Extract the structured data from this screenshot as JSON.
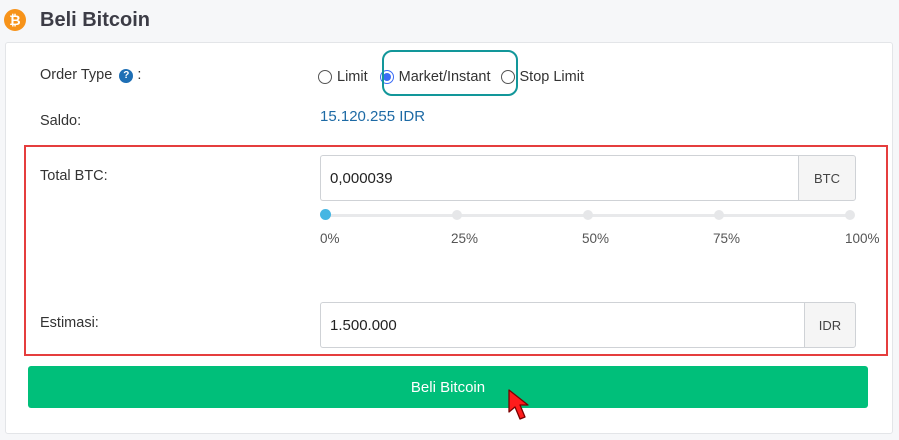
{
  "header": {
    "title": "Beli Bitcoin",
    "logo_glyph": "₿"
  },
  "order_type": {
    "label": "Order Type",
    "suffix": ":",
    "help_glyph": "?",
    "options": [
      {
        "label": "Limit",
        "checked": false
      },
      {
        "label": "Market/Instant",
        "checked": true
      },
      {
        "label": "Stop Limit",
        "checked": false
      }
    ]
  },
  "saldo": {
    "label": "Saldo:",
    "value": "15.120.255 IDR"
  },
  "total_btc": {
    "label": "Total BTC:",
    "value": "0,000039",
    "unit": "BTC"
  },
  "slider": {
    "value_percent": 0,
    "ticks": [
      "0%",
      "25%",
      "50%",
      "75%",
      "100%"
    ]
  },
  "estimasi": {
    "label": "Estimasi:",
    "value": "1.500.000",
    "unit": "IDR"
  },
  "buy_button": {
    "label": "Beli Bitcoin"
  },
  "colors": {
    "accent_green": "#00bf7a",
    "highlight_red": "#e53d3d",
    "highlight_teal": "#12979a",
    "saldo_blue": "#1d6aa5",
    "bitcoin_orange": "#f7931a"
  }
}
